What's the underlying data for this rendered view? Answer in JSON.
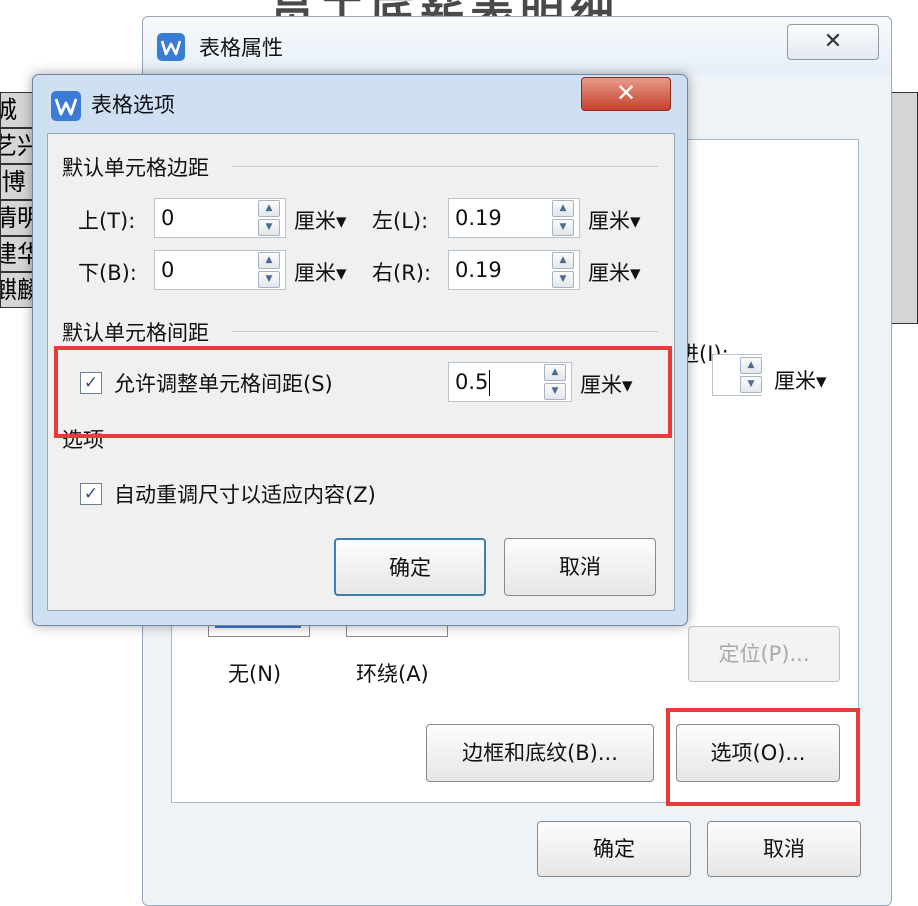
{
  "background": {
    "doc_title": "员工底薪表明细",
    "left_cells": [
      "城",
      "艺兴",
      "-博",
      "情明",
      "建华",
      "麒麟"
    ]
  },
  "outer_dialog": {
    "title": "表格属性",
    "close_glyph": "✕",
    "indent_label_fragment": "进(I):",
    "indent_unit": "厘米▾",
    "wrap_none_label": "无(N)",
    "wrap_around_label": "环绕(A)",
    "position_button": "定位(P)...",
    "borders_button": "边框和底纹(B)...",
    "options_button": "选项(O)...",
    "ok_button": "确定",
    "cancel_button": "取消"
  },
  "inner_dialog": {
    "title": "表格选项",
    "close_glyph": "✕",
    "margins_section": "默认单元格边距",
    "top_label": "上(T):",
    "top_value": "0",
    "top_unit": "厘米▾",
    "left_label": "左(L):",
    "left_value": "0.19",
    "left_unit": "厘米▾",
    "bottom_label": "下(B):",
    "bottom_value": "0",
    "bottom_unit": "厘米▾",
    "right_label": "右(R):",
    "right_value": "0.19",
    "right_unit": "厘米▾",
    "spacing_section": "默认单元格间距",
    "allow_spacing_label": "允许调整单元格间距(S)",
    "allow_spacing_checked": true,
    "spacing_value": "0.5",
    "spacing_unit": "厘米▾",
    "options_section": "选项",
    "auto_resize_label": "自动重调尺寸以适应内容(Z)",
    "auto_resize_checked": true,
    "ok_button": "确定",
    "cancel_button": "取消"
  },
  "icons": {
    "app": "wps-writer-icon",
    "spin_up": "▲",
    "spin_down": "▼",
    "check": "✓"
  },
  "colors": {
    "highlight": "#e83c3c",
    "app_icon": "#3a7bd5"
  }
}
